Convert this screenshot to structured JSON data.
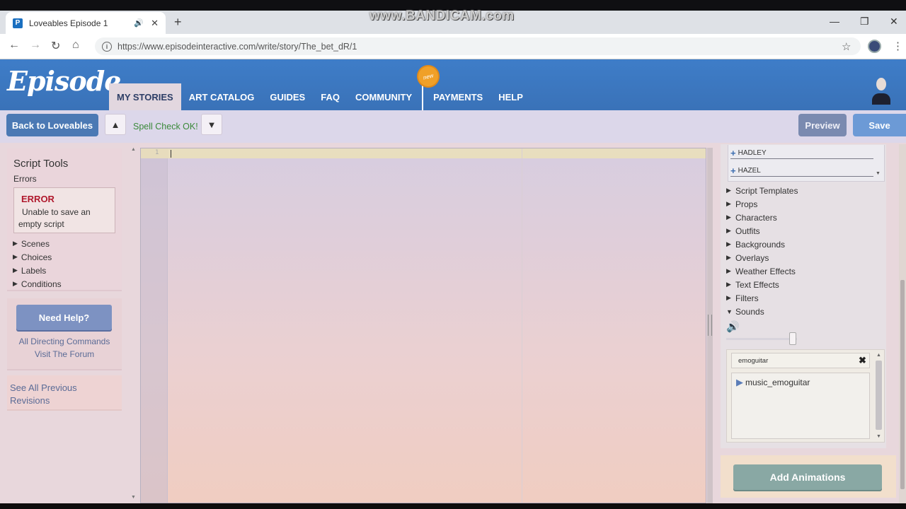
{
  "browser": {
    "tab_title": "Loveables Episode 1",
    "favicon_letter": "P",
    "url": "https://www.episodeinteractive.com/write/story/The_bet_dR/1",
    "watermark": "www.BANDICAM.com"
  },
  "site": {
    "logo": "Episode",
    "new_badge": "new",
    "nav": [
      {
        "label": "MY STORIES",
        "active": true
      },
      {
        "label": "ART CATALOG"
      },
      {
        "label": "GUIDES"
      },
      {
        "label": "FAQ"
      },
      {
        "label": "COMMUNITY"
      },
      {
        "label": "PAYMENTS"
      },
      {
        "label": "HELP"
      }
    ]
  },
  "toolbar": {
    "back_label": "Back to Loveables",
    "spellcheck": "Spell Check OK!",
    "preview_label": "Preview",
    "save_label": "Save"
  },
  "script_tools": {
    "title": "Script Tools",
    "errors_label": "Errors",
    "error_title": "ERROR",
    "error_message": "Unable to save an empty script",
    "items": [
      "Scenes",
      "Choices",
      "Labels",
      "Conditions"
    ]
  },
  "help": {
    "button": "Need Help?",
    "link1": "All Directing Commands",
    "link2": "Visit The Forum",
    "revisions": "See All Previous Revisions"
  },
  "editor": {
    "line_number": "1"
  },
  "right_panel": {
    "characters": [
      "HADLEY",
      "HAZEL"
    ],
    "sections": [
      {
        "label": "Script Templates",
        "expanded": false
      },
      {
        "label": "Props",
        "expanded": false
      },
      {
        "label": "Characters",
        "expanded": false
      },
      {
        "label": "Outfits",
        "expanded": false
      },
      {
        "label": "Backgrounds",
        "expanded": false
      },
      {
        "label": "Overlays",
        "expanded": false
      },
      {
        "label": "Weather Effects",
        "expanded": false
      },
      {
        "label": "Text Effects",
        "expanded": false
      },
      {
        "label": "Filters",
        "expanded": false
      },
      {
        "label": "Sounds",
        "expanded": true
      }
    ],
    "sound_search": "emoguitar",
    "sound_results": [
      "music_emoguitar"
    ],
    "add_animations": "Add Animations"
  },
  "colors": {
    "header_blue": "#3e7dc8",
    "error_red": "#b0182c",
    "spell_ok_green": "#3a8a3a",
    "save_blue": "#6c9ad6"
  }
}
